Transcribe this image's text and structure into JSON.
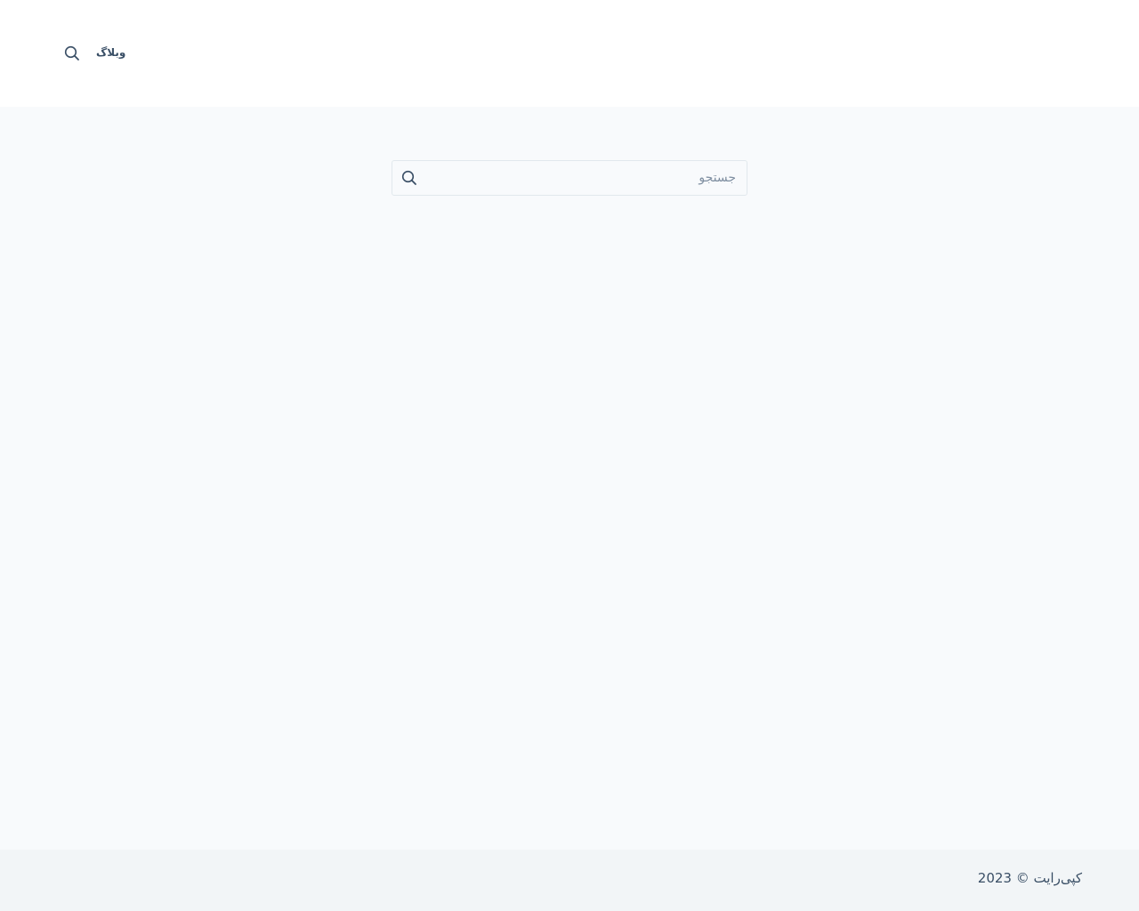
{
  "header": {
    "nav_items": [
      {
        "label": "وبلاگ"
      }
    ],
    "search_icon": "search-icon"
  },
  "search": {
    "placeholder": "جستجو",
    "value": "",
    "submit_icon": "search-icon"
  },
  "footer": {
    "copyright": "کپی‌رایت © 2023"
  },
  "colors": {
    "header_bg": "#ffffff",
    "page_bg": "#f8fafc",
    "footer_bg": "#f2f5f7",
    "text": "#3a4f66",
    "border": "#e1e8ed"
  }
}
